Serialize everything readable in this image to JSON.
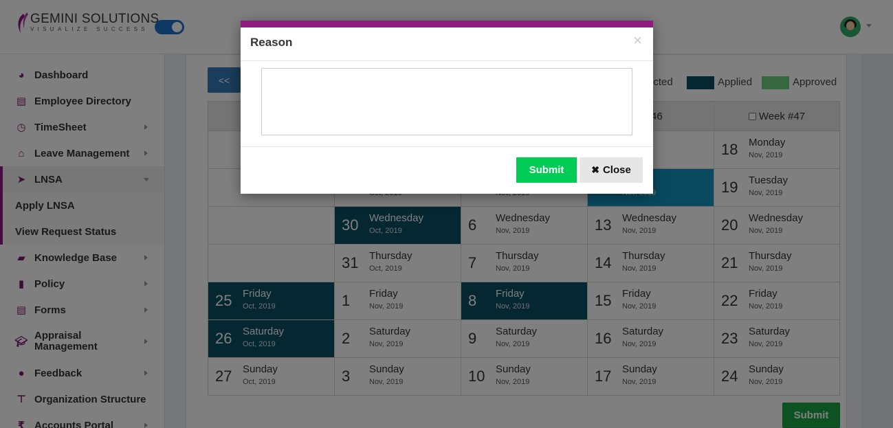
{
  "brand": {
    "name": "GEMINI SOLUTIONS",
    "tagline": "VISUALIZE SUCCESS",
    "accent": "#8e1b80"
  },
  "sidebar": {
    "items": [
      {
        "label": "Dashboard",
        "icon": "dashboard-icon"
      },
      {
        "label": "Employee Directory",
        "icon": "address-book-icon"
      },
      {
        "label": "TimeSheet",
        "icon": "clock-icon"
      },
      {
        "label": "Leave Management",
        "icon": "home-icon"
      },
      {
        "label": "LNSA",
        "icon": "paper-plane-icon"
      },
      {
        "label": "Apply LNSA"
      },
      {
        "label": "View Request Status"
      },
      {
        "label": "Knowledge Base",
        "icon": "folder-open-icon"
      },
      {
        "label": "Policy",
        "icon": "file-icon"
      },
      {
        "label": "Forms",
        "icon": "file-text-icon"
      },
      {
        "label": "Appraisal Management",
        "icon": "graduation-cap-icon"
      },
      {
        "label": "Feedback",
        "icon": "comments-icon"
      },
      {
        "label": "Organization Structure",
        "icon": "sitemap-icon"
      },
      {
        "label": "Accounts Portal",
        "icon": "rupee-icon"
      }
    ]
  },
  "calendar": {
    "prev_label": "<<",
    "legend": {
      "rejected": "ected",
      "applied": "Applied",
      "approved": "Approved",
      "applied_color": "#084e63",
      "approved_color": "#6ccf7e"
    },
    "headers": [
      "",
      "",
      "",
      "k #46",
      "Week #47"
    ],
    "rows": [
      [
        null,
        null,
        null,
        {
          "num": "",
          "day": "ay",
          "mon": ""
        },
        {
          "num": "18",
          "day": "Monday",
          "mon": "Nov, 2019"
        }
      ],
      [
        null,
        {
          "num": "",
          "day": "",
          "mon": "Oct, 2019"
        },
        {
          "num": "",
          "day": "",
          "mon": "Nov, 2019"
        },
        {
          "num": "",
          "day": "ay",
          "mon": "Nov, 2019",
          "state": "bright"
        },
        {
          "num": "19",
          "day": "Tuesday",
          "mon": "Nov, 2019"
        }
      ],
      [
        null,
        {
          "num": "30",
          "day": "Wednesday",
          "mon": "Oct, 2019",
          "state": "applied"
        },
        {
          "num": "6",
          "day": "Wednesday",
          "mon": "Nov, 2019"
        },
        {
          "num": "13",
          "day": "Wednesday",
          "mon": "Nov, 2019"
        },
        {
          "num": "20",
          "day": "Wednesday",
          "mon": "Nov, 2019"
        }
      ],
      [
        null,
        {
          "num": "31",
          "day": "Thursday",
          "mon": "Oct, 2019"
        },
        {
          "num": "7",
          "day": "Thursday",
          "mon": "Nov, 2019"
        },
        {
          "num": "14",
          "day": "Thursday",
          "mon": "Nov, 2019"
        },
        {
          "num": "21",
          "day": "Thursday",
          "mon": "Nov, 2019"
        }
      ],
      [
        {
          "num": "25",
          "day": "Friday",
          "mon": "Oct, 2019",
          "state": "applied"
        },
        {
          "num": "1",
          "day": "Friday",
          "mon": "Nov, 2019"
        },
        {
          "num": "8",
          "day": "Friday",
          "mon": "Nov, 2019",
          "state": "applied"
        },
        {
          "num": "15",
          "day": "Friday",
          "mon": "Nov, 2019"
        },
        {
          "num": "22",
          "day": "Friday",
          "mon": "Nov, 2019"
        }
      ],
      [
        {
          "num": "26",
          "day": "Saturday",
          "mon": "Oct, 2019",
          "state": "applied"
        },
        {
          "num": "2",
          "day": "Saturday",
          "mon": "Nov, 2019"
        },
        {
          "num": "9",
          "day": "Saturday",
          "mon": "Nov, 2019"
        },
        {
          "num": "16",
          "day": "Saturday",
          "mon": "Nov, 2019"
        },
        {
          "num": "23",
          "day": "Saturday",
          "mon": "Nov, 2019"
        }
      ],
      [
        {
          "num": "27",
          "day": "Sunday",
          "mon": "Oct, 2019"
        },
        {
          "num": "3",
          "day": "Sunday",
          "mon": "Nov, 2019"
        },
        {
          "num": "10",
          "day": "Sunday",
          "mon": "Nov, 2019"
        },
        {
          "num": "17",
          "day": "Sunday",
          "mon": "Nov, 2019"
        },
        {
          "num": "24",
          "day": "Sunday",
          "mon": "Nov, 2019"
        }
      ]
    ],
    "submit_label": "Submit"
  },
  "modal": {
    "title": "Reason",
    "close_x": "×",
    "textarea_value": "",
    "submit_label": "Submit",
    "close_label": "Close"
  }
}
